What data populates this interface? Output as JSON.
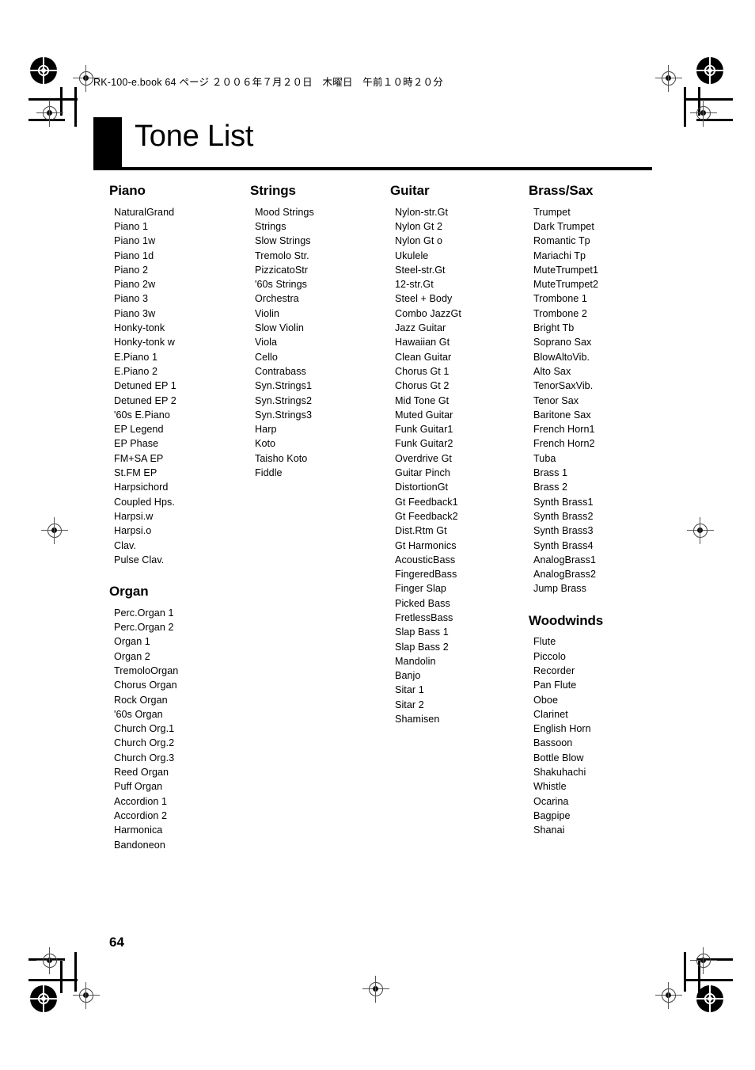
{
  "document": {
    "header_note": "RK-100-e.book 64 ページ ２００６年７月２０日　木曜日　午前１０時２０分",
    "title": "Tone List",
    "page_number": "64"
  },
  "columns": [
    {
      "groups": [
        {
          "heading": "Piano",
          "items": [
            "NaturalGrand",
            "Piano 1",
            "Piano 1w",
            "Piano 1d",
            "Piano 2",
            "Piano 2w",
            "Piano 3",
            "Piano 3w",
            "Honky-tonk",
            "Honky-tonk w",
            "E.Piano 1",
            "E.Piano 2",
            "Detuned EP 1",
            "Detuned EP 2",
            "'60s E.Piano",
            "EP Legend",
            "EP Phase",
            "FM+SA EP",
            "St.FM EP",
            "Harpsichord",
            "Coupled Hps.",
            "Harpsi.w",
            "Harpsi.o",
            "Clav.",
            "Pulse Clav."
          ]
        },
        {
          "heading": "Organ",
          "items": [
            "Perc.Organ 1",
            "Perc.Organ 2",
            "Organ 1",
            "Organ 2",
            "TremoloOrgan",
            "Chorus Organ",
            "Rock Organ",
            "'60s Organ",
            "Church Org.1",
            "Church Org.2",
            "Church Org.3",
            "Reed Organ",
            "Puff Organ",
            "Accordion 1",
            "Accordion 2",
            "Harmonica",
            "Bandoneon"
          ]
        }
      ]
    },
    {
      "groups": [
        {
          "heading": "Strings",
          "items": [
            "Mood Strings",
            "Strings",
            "Slow Strings",
            "Tremolo Str.",
            "PizzicatoStr",
            "'60s Strings",
            "Orchestra",
            "Violin",
            "Slow Violin",
            "Viola",
            "Cello",
            "Contrabass",
            "Syn.Strings1",
            "Syn.Strings2",
            "Syn.Strings3",
            "Harp",
            "Koto",
            "Taisho Koto",
            "Fiddle"
          ]
        }
      ]
    },
    {
      "groups": [
        {
          "heading": "Guitar",
          "items": [
            "Nylon-str.Gt",
            "Nylon Gt 2",
            "Nylon Gt o",
            "Ukulele",
            "Steel-str.Gt",
            "12-str.Gt",
            "Steel + Body",
            "Combo JazzGt",
            "Jazz Guitar",
            "Hawaiian Gt",
            "Clean Guitar",
            "Chorus Gt 1",
            "Chorus Gt 2",
            "Mid Tone Gt",
            "Muted Guitar",
            "Funk Guitar1",
            "Funk Guitar2",
            "Overdrive Gt",
            "Guitar Pinch",
            "DistortionGt",
            "Gt Feedback1",
            "Gt Feedback2",
            "Dist.Rtm Gt",
            "Gt Harmonics",
            "AcousticBass",
            "FingeredBass",
            "Finger Slap",
            "Picked Bass",
            "FretlessBass",
            "Slap Bass 1",
            "Slap Bass 2",
            "Mandolin",
            "Banjo",
            "Sitar 1",
            "Sitar 2",
            "Shamisen"
          ]
        }
      ]
    },
    {
      "groups": [
        {
          "heading": "Brass/Sax",
          "items": [
            "Trumpet",
            "Dark Trumpet",
            "Romantic Tp",
            "Mariachi Tp",
            "MuteTrumpet1",
            "MuteTrumpet2",
            "Trombone 1",
            "Trombone 2",
            "Bright Tb",
            "Soprano Sax",
            "BlowAltoVib.",
            "Alto Sax",
            "TenorSaxVib.",
            "Tenor Sax",
            "Baritone Sax",
            "French Horn1",
            "French Horn2",
            "Tuba",
            "Brass 1",
            "Brass 2",
            "Synth Brass1",
            "Synth Brass2",
            "Synth Brass3",
            "Synth Brass4",
            "AnalogBrass1",
            "AnalogBrass2",
            "Jump Brass"
          ]
        },
        {
          "heading": "Woodwinds",
          "items": [
            "Flute",
            "Piccolo",
            "Recorder",
            "Pan Flute",
            "Oboe",
            "Clarinet",
            "English Horn",
            "Bassoon",
            "Bottle Blow",
            "Shakuhachi",
            "Whistle",
            "Ocarina",
            "Bagpipe",
            "Shanai"
          ]
        }
      ]
    }
  ]
}
